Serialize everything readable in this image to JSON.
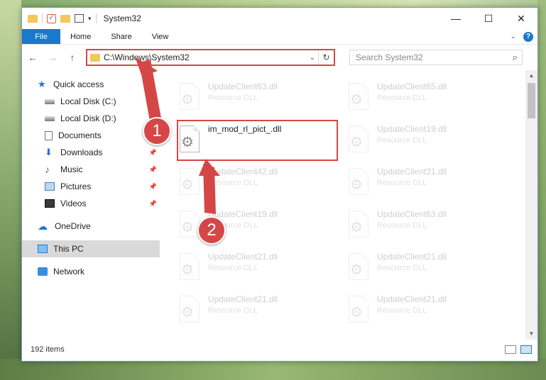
{
  "window": {
    "title": "System32",
    "controls": {
      "minimize": "—",
      "maximize": "☐",
      "close": "✕"
    }
  },
  "ribbon": {
    "file": "File",
    "tabs": [
      "Home",
      "Share",
      "View"
    ]
  },
  "nav": {
    "back": "←",
    "forward": "→",
    "up": "↑",
    "address": "C:\\Windows\\System32",
    "search_placeholder": "Search System32"
  },
  "sidebar": {
    "quick_access": "Quick access",
    "items": [
      {
        "label": "Local Disk (C:)",
        "icon": "disk-icon",
        "pinned": false
      },
      {
        "label": "Local Disk (D:)",
        "icon": "disk-icon",
        "pinned": false
      },
      {
        "label": "Documents",
        "icon": "documents-icon",
        "pinned": true
      },
      {
        "label": "Downloads",
        "icon": "download-icon",
        "pinned": true
      },
      {
        "label": "Music",
        "icon": "music-icon",
        "pinned": true
      },
      {
        "label": "Pictures",
        "icon": "pictures-icon",
        "pinned": true
      },
      {
        "label": "Videos",
        "icon": "videos-icon",
        "pinned": true
      }
    ],
    "onedrive": "OneDrive",
    "this_pc": "This PC",
    "network": "Network"
  },
  "files": {
    "left_column": [
      {
        "name": "UpdateClient63.dll",
        "desc": "Resource DLL"
      },
      {
        "name": "im_mod_rl_pict_.dll",
        "desc": ""
      },
      {
        "name": "UpdateClient42.dll",
        "desc": "Resource DLL"
      },
      {
        "name": "UpdateClient19.dll",
        "desc": "Resource DLL"
      },
      {
        "name": "UpdateClient21.dll",
        "desc": "Resource DLL"
      },
      {
        "name": "UpdateClient21.dll",
        "desc": "Resource DLL"
      }
    ],
    "right_column": [
      {
        "name": "UpdateClient65.dll",
        "desc": "Resource DLL"
      },
      {
        "name": "UpdateClient19.dll",
        "desc": "Resource DLL"
      },
      {
        "name": "UpdateClient21.dll",
        "desc": "Resource DLL"
      },
      {
        "name": "UpdateClient63.dll",
        "desc": "Resource DLL"
      },
      {
        "name": "UpdateClient21.dll",
        "desc": "Resource DLL"
      },
      {
        "name": "UpdateClient21.dll",
        "desc": "Resource DLL"
      }
    ]
  },
  "status": {
    "item_count": "192 items"
  },
  "callouts": [
    "1",
    "2"
  ],
  "colors": {
    "accent": "#1979ca",
    "highlight": "#d54747"
  }
}
